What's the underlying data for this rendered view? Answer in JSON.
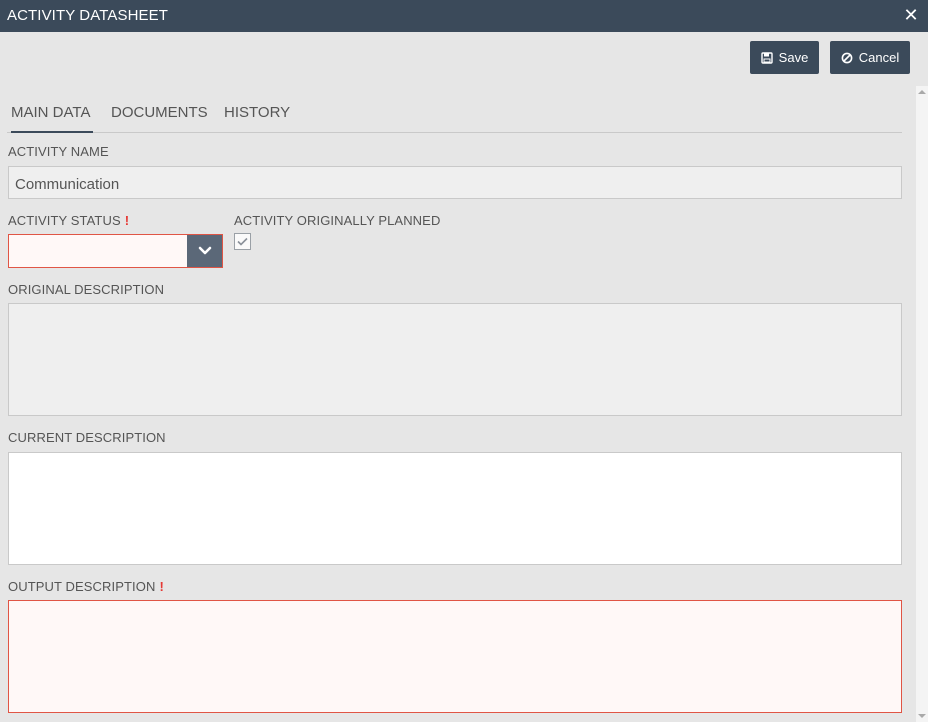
{
  "window": {
    "title": "ACTIVITY DATASHEET",
    "close_icon": "close-icon"
  },
  "toolbar": {
    "save_label": "Save",
    "cancel_label": "Cancel"
  },
  "tabs": [
    {
      "label": "MAIN DATA",
      "active": true
    },
    {
      "label": "DOCUMENTS",
      "active": false
    },
    {
      "label": "HISTORY",
      "active": false
    }
  ],
  "form": {
    "activity_name": {
      "label": "ACTIVITY NAME",
      "value": "Communication"
    },
    "activity_status": {
      "label": "ACTIVITY STATUS",
      "required_mark": "!",
      "value": ""
    },
    "originally_planned": {
      "label": "ACTIVITY ORIGINALLY PLANNED",
      "checked": true
    },
    "original_description": {
      "label": "ORIGINAL DESCRIPTION",
      "value": ""
    },
    "current_description": {
      "label": "CURRENT DESCRIPTION",
      "value": ""
    },
    "output_description": {
      "label": "OUTPUT DESCRIPTION",
      "required_mark": "!",
      "value": ""
    }
  },
  "colors": {
    "header_bg": "#3b4a5a",
    "required": "#e53935",
    "error_border": "#e05545"
  }
}
